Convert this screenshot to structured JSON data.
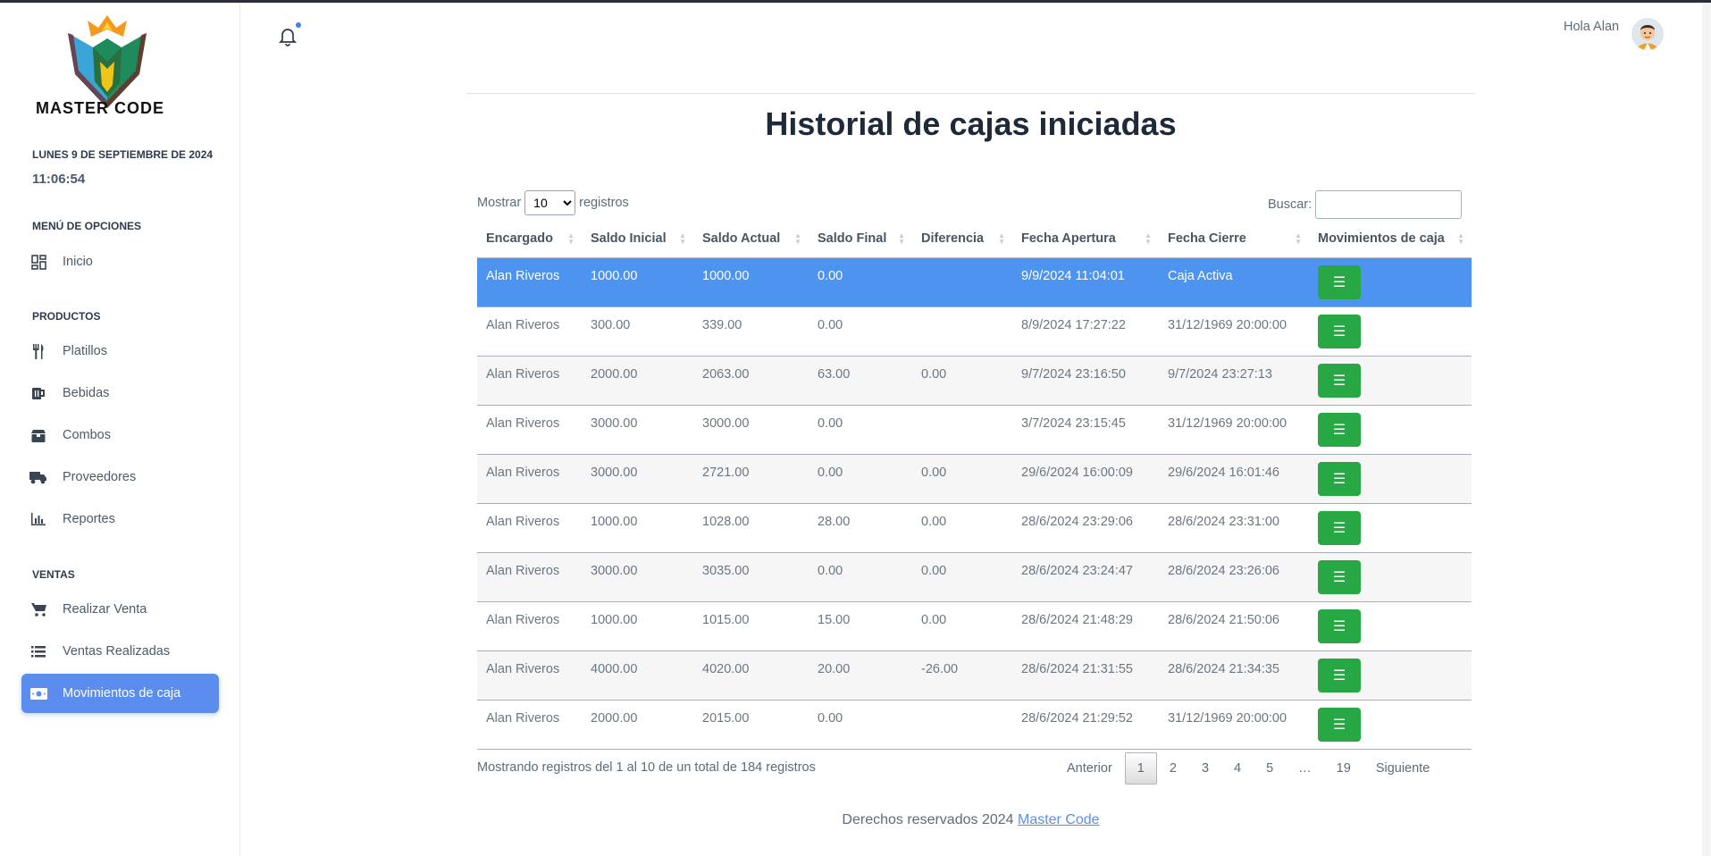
{
  "brand": {
    "name": "MASTER CODE",
    "colors": {
      "accent": "#5b8def",
      "success": "#28a745",
      "selected_row": "#4d94f0"
    }
  },
  "sidebar": {
    "date": "LUNES 9 DE SEPTIEMBRE DE 2024",
    "time": "11:06:54",
    "sections": [
      {
        "title": "MENÚ DE OPCIONES",
        "items": [
          {
            "label": "Inicio",
            "icon": "dashboard-icon"
          }
        ]
      },
      {
        "title": "PRODUCTOS",
        "items": [
          {
            "label": "Platillos",
            "icon": "utensils-icon"
          },
          {
            "label": "Bebidas",
            "icon": "beer-mug-icon"
          },
          {
            "label": "Combos",
            "icon": "box-icon"
          },
          {
            "label": "Proveedores",
            "icon": "truck-icon"
          },
          {
            "label": "Reportes",
            "icon": "bar-chart-icon"
          }
        ]
      },
      {
        "title": "VENTAS",
        "items": [
          {
            "label": "Realizar Venta",
            "icon": "cart-icon"
          },
          {
            "label": "Ventas Realizadas",
            "icon": "list-icon"
          },
          {
            "label": "Movimientos de caja",
            "icon": "money-bill-icon",
            "active": true
          }
        ]
      }
    ]
  },
  "header": {
    "greeting": "Hola Alan",
    "notification_icon": "bell-icon"
  },
  "main": {
    "title": "Historial de cajas iniciadas",
    "length": {
      "prefix": "Mostrar",
      "selected": "10",
      "suffix": "registros"
    },
    "search": {
      "label": "Buscar:",
      "value": "",
      "placeholder": ""
    },
    "columns": [
      "Encargado",
      "Saldo Inicial",
      "Saldo Actual",
      "Saldo Final",
      "Diferencia",
      "Fecha Apertura",
      "Fecha Cierre",
      "Movimientos de caja"
    ],
    "rows": [
      [
        "Alan Riveros",
        "1000.00",
        "1000.00",
        "0.00",
        "",
        "9/9/2024 11:04:01",
        "Caja Activa"
      ],
      [
        "Alan Riveros",
        "300.00",
        "339.00",
        "0.00",
        "",
        "8/9/2024 17:27:22",
        "31/12/1969 20:00:00"
      ],
      [
        "Alan Riveros",
        "2000.00",
        "2063.00",
        "63.00",
        "0.00",
        "9/7/2024 23:16:50",
        "9/7/2024 23:27:13"
      ],
      [
        "Alan Riveros",
        "3000.00",
        "3000.00",
        "0.00",
        "",
        "3/7/2024 23:15:45",
        "31/12/1969 20:00:00"
      ],
      [
        "Alan Riveros",
        "3000.00",
        "2721.00",
        "0.00",
        "0.00",
        "29/6/2024 16:00:09",
        "29/6/2024 16:01:46"
      ],
      [
        "Alan Riveros",
        "1000.00",
        "1028.00",
        "28.00",
        "0.00",
        "28/6/2024 23:29:06",
        "28/6/2024 23:31:00"
      ],
      [
        "Alan Riveros",
        "3000.00",
        "3035.00",
        "0.00",
        "0.00",
        "28/6/2024 23:24:47",
        "28/6/2024 23:26:06"
      ],
      [
        "Alan Riveros",
        "1000.00",
        "1015.00",
        "15.00",
        "0.00",
        "28/6/2024 21:48:29",
        "28/6/2024 21:50:06"
      ],
      [
        "Alan Riveros",
        "4000.00",
        "4020.00",
        "20.00",
        "-26.00",
        "28/6/2024 21:31:55",
        "28/6/2024 21:34:35"
      ],
      [
        "Alan Riveros",
        "2000.00",
        "2015.00",
        "0.00",
        "",
        "28/6/2024 21:29:52",
        "31/12/1969 20:00:00"
      ]
    ],
    "info": "Mostrando registros del 1 al 10 de un total de 184 registros",
    "pagination": {
      "prev": "Anterior",
      "pages": [
        "1",
        "2",
        "3",
        "4",
        "5",
        "…",
        "19"
      ],
      "current": "1",
      "next": "Siguiente"
    },
    "footer": {
      "text": "Derechos reservados 2024",
      "link": "Master Code"
    }
  }
}
